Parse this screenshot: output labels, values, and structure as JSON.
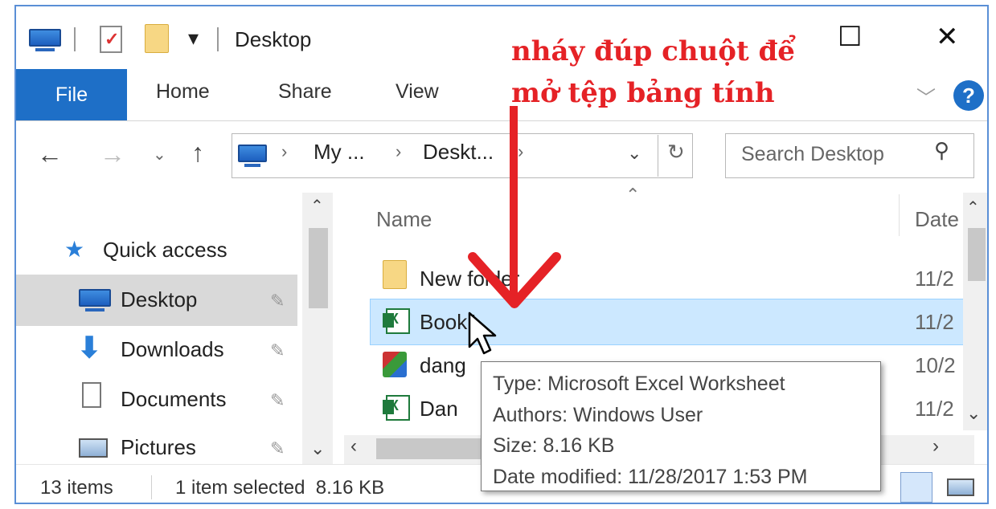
{
  "window": {
    "title": "Desktop"
  },
  "window_controls": {
    "maximize": "☐",
    "close": "✕"
  },
  "ribbon": {
    "tabs": [
      "File",
      "Home",
      "Share",
      "View"
    ]
  },
  "address": {
    "segments": [
      "My ...",
      "Deskt..."
    ],
    "search_placeholder": "Search Desktop"
  },
  "nav_pane": {
    "quick_access": "Quick access",
    "items": [
      {
        "label": "Desktop",
        "icon": "desktop-icon",
        "selected": true
      },
      {
        "label": "Downloads",
        "icon": "downloads-icon"
      },
      {
        "label": "Documents",
        "icon": "documents-icon"
      },
      {
        "label": "Pictures",
        "icon": "pictures-icon"
      }
    ]
  },
  "file_list": {
    "columns": [
      "Name",
      "Date"
    ],
    "rows": [
      {
        "name": "New folder",
        "date": "11/2",
        "icon": "folder-icon"
      },
      {
        "name": "Book1",
        "date": "11/2",
        "icon": "excel-file-icon",
        "selected": true
      },
      {
        "name": "dang",
        "date": "10/2",
        "icon": "image-file-icon"
      },
      {
        "name": "Dan",
        "date": "11/2",
        "icon": "excel-file-icon"
      }
    ]
  },
  "tooltip": {
    "lines": [
      "Type: Microsoft Excel Worksheet",
      "Authors: Windows User",
      "Size: 8.16 KB",
      "Date modified: 11/28/2017 1:53 PM"
    ]
  },
  "status_bar": {
    "count": "13 items",
    "selection": "1 item selected  8.16 KB"
  },
  "annotation": {
    "line1": "nháy đúp chuột để",
    "line2": "mở tệp bảng tính"
  },
  "colors": {
    "accent": "#1e6fc7",
    "annotation": "#e52226",
    "selection": "#cce8ff"
  }
}
